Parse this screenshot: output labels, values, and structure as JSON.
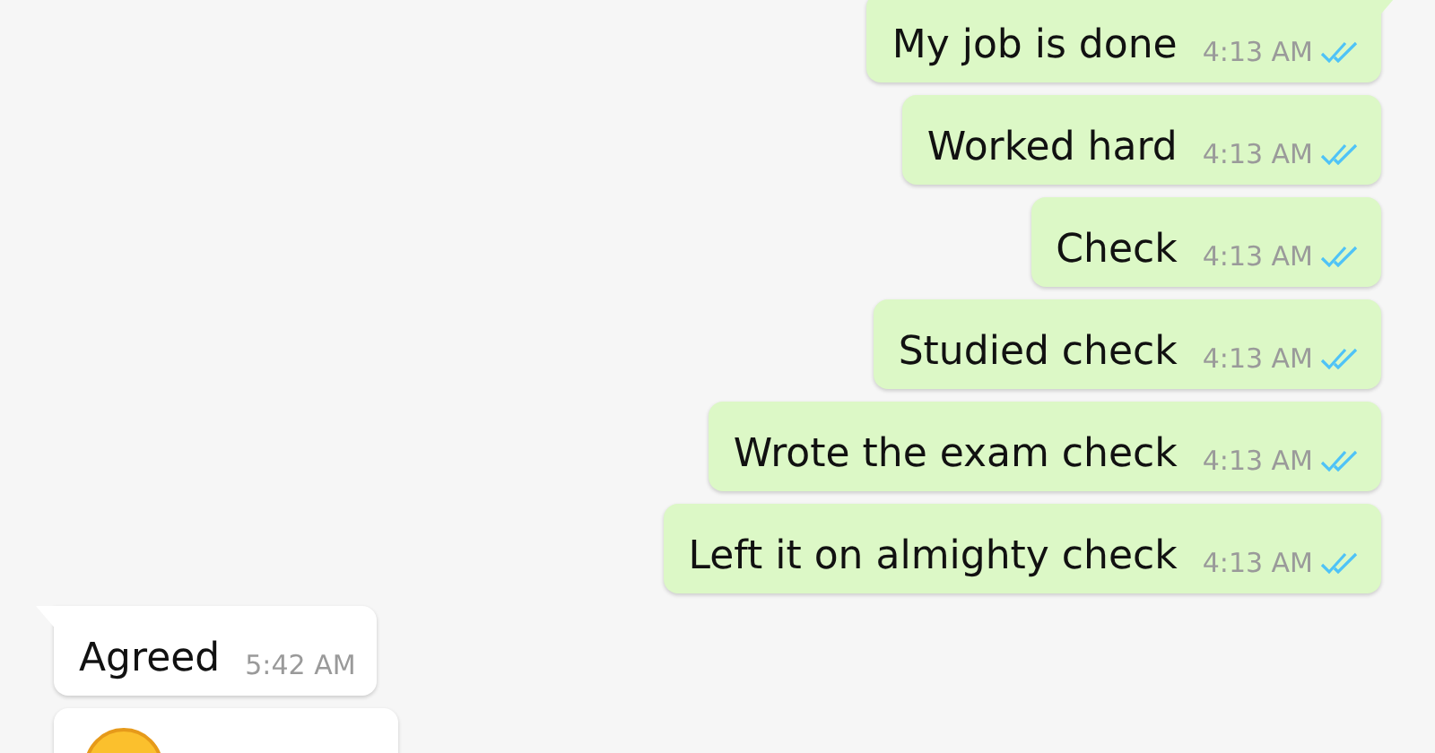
{
  "messages": [
    {
      "outgoing": true,
      "kind": "text",
      "text": "My job is done",
      "time": "4:13 AM",
      "read": true,
      "tail": true
    },
    {
      "outgoing": true,
      "kind": "text",
      "text": "Worked hard",
      "time": "4:13 AM",
      "read": true,
      "tail": false
    },
    {
      "outgoing": true,
      "kind": "text",
      "text": "Check",
      "time": "4:13 AM",
      "read": true,
      "tail": false
    },
    {
      "outgoing": true,
      "kind": "text",
      "text": "Studied check",
      "time": "4:13 AM",
      "read": true,
      "tail": false
    },
    {
      "outgoing": true,
      "kind": "text",
      "text": "Wrote the exam check",
      "time": "4:13 AM",
      "read": true,
      "tail": false
    },
    {
      "outgoing": true,
      "kind": "text",
      "text": "Left it on almighty check",
      "time": "4:13 AM",
      "read": true,
      "tail": false
    },
    {
      "outgoing": false,
      "kind": "text",
      "text": "Agreed",
      "time": "5:42 AM",
      "tail": true
    },
    {
      "outgoing": false,
      "kind": "emoji",
      "tail": false
    }
  ]
}
